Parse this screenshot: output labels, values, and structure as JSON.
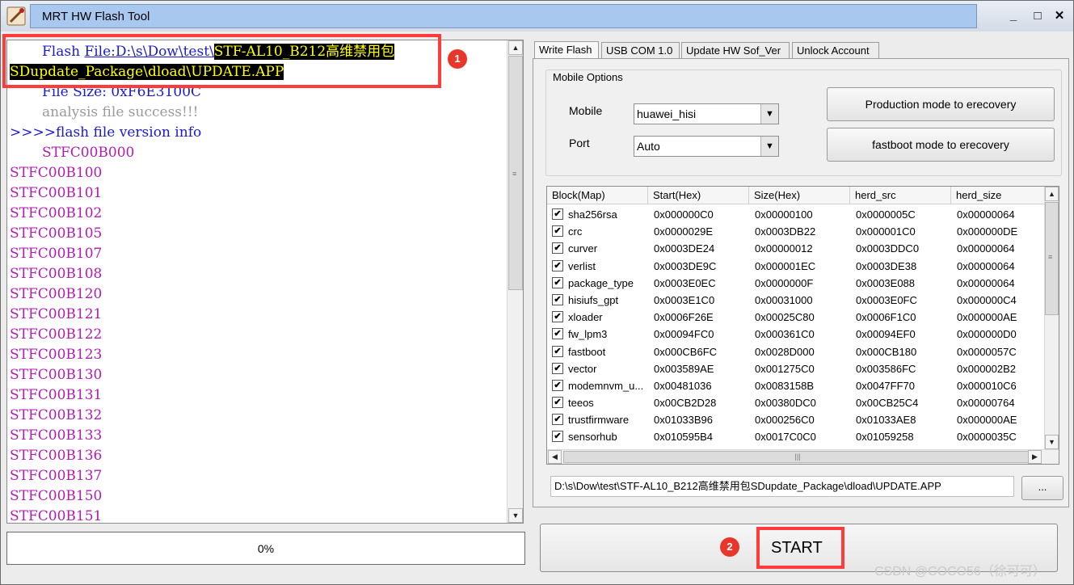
{
  "window": {
    "title": "MRT HW Flash Tool",
    "minimize": "_",
    "maximize": "□",
    "close": "✕"
  },
  "log": {
    "lines": [
      {
        "parts": [
          {
            "t": "Flash ",
            "c": "blue"
          },
          {
            "t": "File:D:\\s\\Dow\\test\\",
            "c": "link"
          },
          {
            "t": "STF-AL10_B212高维禁用包",
            "c": "hl"
          }
        ],
        "indent": true
      },
      {
        "parts": [
          {
            "t": "SDupdate_Package\\dload\\UPDATE.APP",
            "c": "hl"
          }
        ],
        "indent": false
      },
      {
        "parts": [
          {
            "t": "File Size: 0xF6E3100C",
            "c": "blue"
          }
        ],
        "indent": true
      },
      {
        "parts": [
          {
            "t": "analysis file success!!!",
            "c": "gray"
          }
        ],
        "indent": true
      },
      {
        "parts": [
          {
            "t": ">>>>flash file version info",
            "c": "blue"
          }
        ],
        "indent": false
      },
      {
        "parts": [
          {
            "t": "STFC00B000",
            "c": "mag"
          }
        ],
        "indent": true
      },
      {
        "parts": [
          {
            "t": "STFC00B100",
            "c": "mag"
          }
        ],
        "indent": false
      },
      {
        "parts": [
          {
            "t": "STFC00B101",
            "c": "mag"
          }
        ],
        "indent": false
      },
      {
        "parts": [
          {
            "t": "STFC00B102",
            "c": "mag"
          }
        ],
        "indent": false
      },
      {
        "parts": [
          {
            "t": "STFC00B105",
            "c": "mag"
          }
        ],
        "indent": false
      },
      {
        "parts": [
          {
            "t": "STFC00B107",
            "c": "mag"
          }
        ],
        "indent": false
      },
      {
        "parts": [
          {
            "t": "STFC00B108",
            "c": "mag"
          }
        ],
        "indent": false
      },
      {
        "parts": [
          {
            "t": "STFC00B120",
            "c": "mag"
          }
        ],
        "indent": false
      },
      {
        "parts": [
          {
            "t": "STFC00B121",
            "c": "mag"
          }
        ],
        "indent": false
      },
      {
        "parts": [
          {
            "t": "STFC00B122",
            "c": "mag"
          }
        ],
        "indent": false
      },
      {
        "parts": [
          {
            "t": "STFC00B123",
            "c": "mag"
          }
        ],
        "indent": false
      },
      {
        "parts": [
          {
            "t": "STFC00B130",
            "c": "mag"
          }
        ],
        "indent": false
      },
      {
        "parts": [
          {
            "t": "STFC00B131",
            "c": "mag"
          }
        ],
        "indent": false
      },
      {
        "parts": [
          {
            "t": "STFC00B132",
            "c": "mag"
          }
        ],
        "indent": false
      },
      {
        "parts": [
          {
            "t": "STFC00B133",
            "c": "mag"
          }
        ],
        "indent": false
      },
      {
        "parts": [
          {
            "t": "STFC00B136",
            "c": "mag"
          }
        ],
        "indent": false
      },
      {
        "parts": [
          {
            "t": "STFC00B137",
            "c": "mag"
          }
        ],
        "indent": false
      },
      {
        "parts": [
          {
            "t": "STFC00B150",
            "c": "mag"
          }
        ],
        "indent": false
      },
      {
        "parts": [
          {
            "t": "STFC00B151",
            "c": "mag"
          }
        ],
        "indent": false
      }
    ]
  },
  "progress": {
    "value": 0,
    "label": "0%"
  },
  "tabs": [
    {
      "label": "Write Flash",
      "active": true
    },
    {
      "label": "USB COM 1.0",
      "active": false
    },
    {
      "label": "Update HW Sof_Ver",
      "active": false
    },
    {
      "label": "Unlock Account",
      "active": false
    }
  ],
  "options": {
    "legend": "Mobile Options",
    "mobile_label": "Mobile",
    "mobile_value": "huawei_hisi",
    "port_label": "Port",
    "port_value": "Auto",
    "production_button": "Production mode to erecovery",
    "fastboot_button": "fastboot mode to erecovery"
  },
  "table": {
    "columns": [
      "Block(Map)",
      "Start(Hex)",
      "Size(Hex)",
      "herd_src",
      "herd_size"
    ],
    "rows": [
      [
        "sha256rsa",
        "0x000000C0",
        "0x00000100",
        "0x0000005C",
        "0x00000064"
      ],
      [
        "crc",
        "0x0000029E",
        "0x0003DB22",
        "0x000001C0",
        "0x000000DE"
      ],
      [
        "curver",
        "0x0003DE24",
        "0x00000012",
        "0x0003DDC0",
        "0x00000064"
      ],
      [
        "verlist",
        "0x0003DE9C",
        "0x000001EC",
        "0x0003DE38",
        "0x00000064"
      ],
      [
        "package_type",
        "0x0003E0EC",
        "0x0000000F",
        "0x0003E088",
        "0x00000064"
      ],
      [
        "hisiufs_gpt",
        "0x0003E1C0",
        "0x00031000",
        "0x0003E0FC",
        "0x000000C4"
      ],
      [
        "xloader",
        "0x0006F26E",
        "0x00025C80",
        "0x0006F1C0",
        "0x000000AE"
      ],
      [
        "fw_lpm3",
        "0x00094FC0",
        "0x000361C0",
        "0x00094EF0",
        "0x000000D0"
      ],
      [
        "fastboot",
        "0x000CB6FC",
        "0x0028D000",
        "0x000CB180",
        "0x0000057C"
      ],
      [
        "vector",
        "0x003589AE",
        "0x001275C0",
        "0x003586FC",
        "0x000002B2"
      ],
      [
        "modemnvm_u...",
        "0x00481036",
        "0x0083158B",
        "0x0047FF70",
        "0x000010C6"
      ],
      [
        "teeos",
        "0x00CB2D28",
        "0x00380DC0",
        "0x00CB25C4",
        "0x00000764"
      ],
      [
        "trustfirmware",
        "0x01033B96",
        "0x000256C0",
        "0x01033AE8",
        "0x000000AE"
      ],
      [
        "sensorhub",
        "0x010595B4",
        "0x0017C0C0",
        "0x01059258",
        "0x0000035C"
      ]
    ],
    "check_mark": "✔"
  },
  "path": {
    "value": "D:\\s\\Dow\\test\\STF-AL10_B212高维禁用包SDupdate_Package\\dload\\UPDATE.APP",
    "browse_label": "..."
  },
  "start": {
    "label": "START"
  },
  "annotations": {
    "badge1": "1",
    "badge2": "2"
  },
  "watermark": "CSDN @COCO56（徐可可）",
  "colors": {
    "highlight_bg": "#000000",
    "highlight_fg": "#ffff00",
    "annotation_red": "#ff3b3b",
    "log_blue": "#1a1ad6",
    "log_magenta": "#b21ab2"
  }
}
